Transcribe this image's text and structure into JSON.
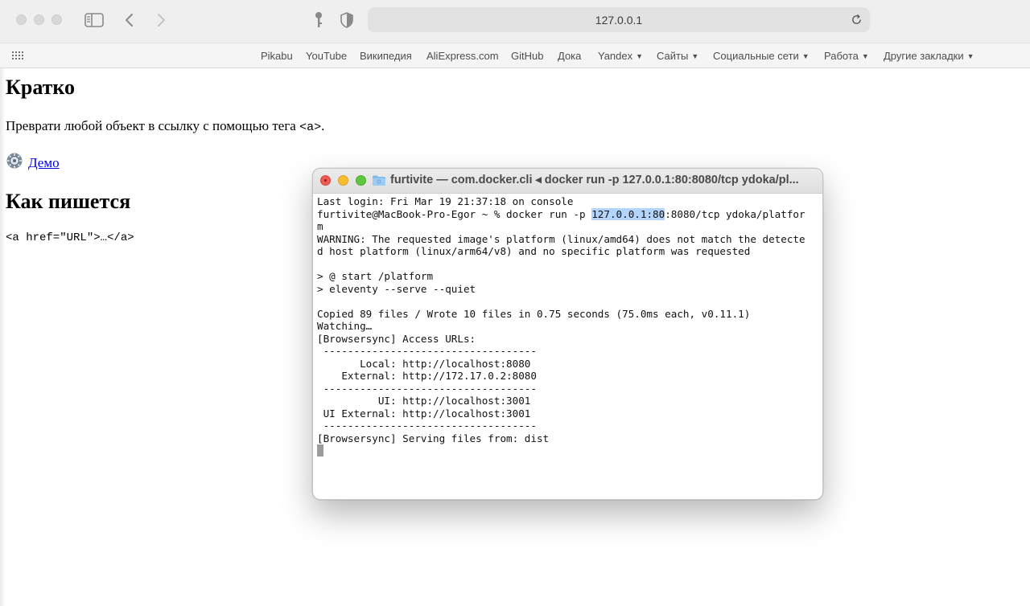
{
  "browser": {
    "url": "127.0.0.1",
    "favorites": [
      {
        "label": "Pikabu",
        "has_menu": false
      },
      {
        "label": "YouTube",
        "has_menu": false
      },
      {
        "label": "Википедия",
        "has_menu": false
      },
      {
        "label": "AliExpress.com",
        "has_menu": false
      },
      {
        "label": "GitHub",
        "has_menu": false
      },
      {
        "label": "Дока",
        "has_menu": false
      },
      {
        "label": "Yandex",
        "has_menu": true
      },
      {
        "label": "Сайты",
        "has_menu": true
      },
      {
        "label": "Социальные сети",
        "has_menu": true
      },
      {
        "label": "Работа",
        "has_menu": true
      },
      {
        "label": "Другие закладки",
        "has_menu": true
      }
    ]
  },
  "page": {
    "heading1": "Кратко",
    "intro_before": "Преврати любой объект в ссылку с помощью тега ",
    "intro_code": "<a>",
    "intro_after": ".",
    "demo_label": "Демо",
    "heading2": "Как пишется",
    "snippet": "<a href=\"URL\">…</a>"
  },
  "terminal": {
    "title": "furtivite — com.docker.cli ◂ docker run -p 127.0.0.1:80:8080/tcp ydoka/pl...",
    "lines": [
      "Last login: Fri Mar 19 21:37:18 on console",
      "furtivite@MacBook-Pro-Egor ~ % docker run -p 127.0.0.1:80:8080/tcp ydoka/platfor",
      "m",
      "WARNING: The requested image's platform (linux/amd64) does not match the detecte",
      "d host platform (linux/arm64/v8) and no specific platform was requested",
      "",
      "> @ start /platform",
      "> eleventy --serve --quiet",
      "",
      "Copied 89 files / Wrote 10 files in 0.75 seconds (75.0ms each, v0.11.1)",
      "Watching…",
      "[Browsersync] Access URLs:",
      " -----------------------------------",
      "       Local: http://localhost:8080",
      "    External: http://172.17.0.2:8080",
      " -----------------------------------",
      "          UI: http://localhost:3001",
      " UI External: http://localhost:3001",
      " -----------------------------------",
      "[Browsersync] Serving files from: dist"
    ],
    "selection": "127.0.0.1:80"
  }
}
